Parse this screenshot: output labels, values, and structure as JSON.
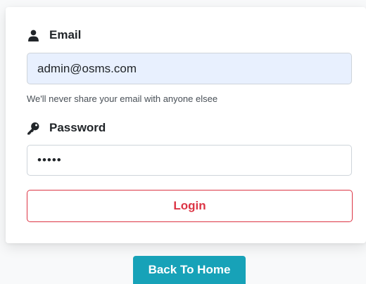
{
  "login_form": {
    "email_label": "Email",
    "email_icon": "user-icon",
    "email_value": "admin@osms.com",
    "email_help": "We'll never share your email with anyone elsee",
    "password_label": "Password",
    "password_icon": "key-icon",
    "password_value": "•••••",
    "login_button": "Login"
  },
  "back_to_home": "Back To Home",
  "colors": {
    "login_accent": "#dc3545",
    "home_button": "#17a2b8",
    "autofill_bg": "#e8f0fe"
  }
}
